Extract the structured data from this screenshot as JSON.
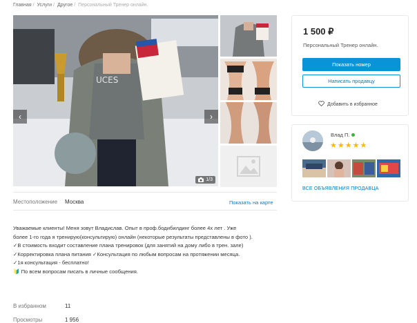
{
  "breadcrumb": {
    "items": [
      "Главная",
      "Услуги",
      "Другое",
      "Персональный Тренер онлайн."
    ]
  },
  "gallery": {
    "counter": "1/3",
    "prev_icon": "chevron-left-icon",
    "next_icon": "chevron-right-icon",
    "camera_icon": "camera-icon",
    "placeholder_icon": "image-placeholder-icon"
  },
  "location": {
    "label": "Местоположение",
    "value": "Москва",
    "map_link": "Показать на карте"
  },
  "description": {
    "lines": [
      "Уважаемые клиенты! Меня зовут Владислав. Опыт в проф.бодибилдинг более 4х лет . Уже",
      "более 1-го года я тренирую(консультирую) онлайн (некоторые результаты представлены в фото ).",
      "✓В стоимость входит составление плана тренировок (для занятий на дому либо в трен. зале)",
      "✓Корректировка плана питания ✓Консультация по любым вопросам на протяжении месяца.",
      "✓1я консультация - бесплатно!",
      "🔰 По всем вопросам писать в личные сообщения."
    ]
  },
  "stats": [
    {
      "label": "В избранном",
      "value": "11"
    },
    {
      "label": "Просмотры",
      "value": "1 956"
    }
  ],
  "listing": {
    "price": "1 500 ₽",
    "title": "Персональный Тренер онлайн.",
    "show_number": "Показать номер",
    "write_seller": "Написать продавцу",
    "favorite": "Добавить в избранное",
    "favorite_icon": "heart-icon"
  },
  "seller": {
    "name": "Влад П.",
    "online": true,
    "rating_stars": "★★★★★",
    "rating": 5,
    "all_listings": "ВСЕ ОБЪЯВЛЕНИЯ ПРОДАВЦА"
  },
  "colors": {
    "accent": "#0a94d8",
    "link": "#0a7abf",
    "star": "#ffb800",
    "online": "#3cb43c"
  }
}
